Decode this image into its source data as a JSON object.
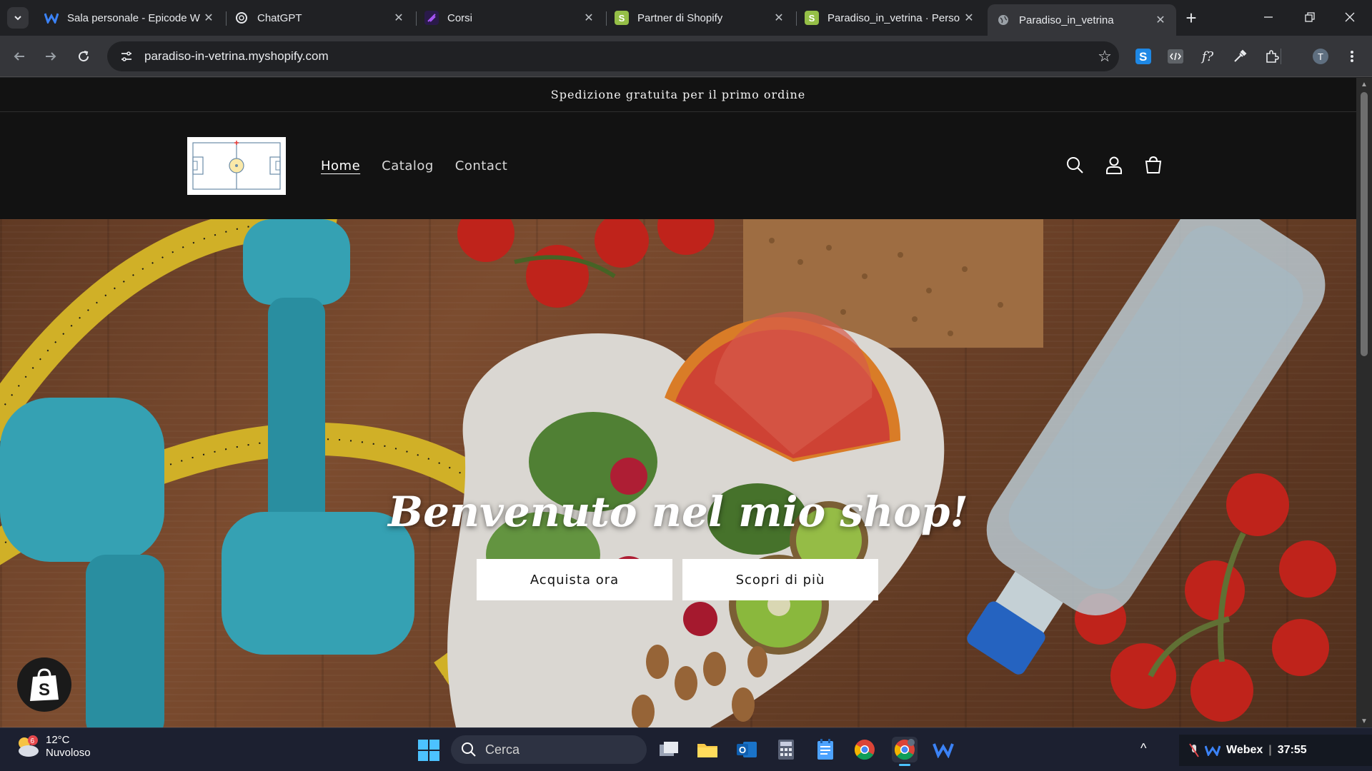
{
  "browser": {
    "tabs": [
      {
        "title": "Sala personale - Epicode W",
        "favicon": "webex-icon",
        "color": "#1f6feb"
      },
      {
        "title": "ChatGPT",
        "favicon": "chatgpt-icon",
        "color": "#ffffff"
      },
      {
        "title": "Corsi",
        "favicon": "corsi-icon",
        "color": "#7b2ff7"
      },
      {
        "title": "Partner di Shopify",
        "favicon": "shopify-icon",
        "color": "#95bf47"
      },
      {
        "title": "Paradiso_in_vetrina · Perso",
        "favicon": "shopify-icon",
        "color": "#95bf47"
      },
      {
        "title": "Paradiso_in_vetrina",
        "favicon": "globe-icon",
        "color": "#9aa0a6"
      }
    ],
    "url": "paradiso-in-vetrina.myshopify.com",
    "profile_initial": "T"
  },
  "store": {
    "announcement": "Spedizione gratuita per il primo ordine",
    "menu": [
      {
        "label": "Home",
        "active": true
      },
      {
        "label": "Catalog",
        "active": false
      },
      {
        "label": "Contact",
        "active": false
      }
    ],
    "hero": {
      "title": "Benvenuto nel mio shop!",
      "primary_button": "Acquista ora",
      "secondary_button": "Scopri di più"
    }
  },
  "taskbar": {
    "weather": {
      "temp": "12°C",
      "condition": "Nuvoloso",
      "badge": "6"
    },
    "search_placeholder": "Cerca",
    "webex": {
      "label": "Webex",
      "timer": "37:55"
    }
  },
  "colors": {
    "page_bg": "#121212",
    "chrome_dark": "#202124",
    "chrome_toolbar": "#35363a",
    "taskbar": "#1c2030"
  }
}
